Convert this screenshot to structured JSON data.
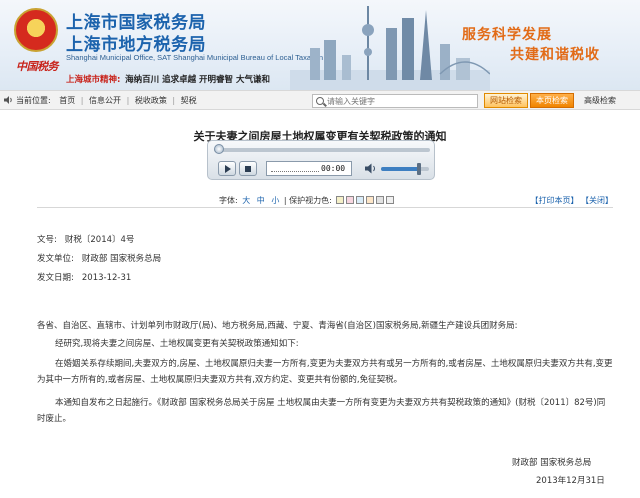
{
  "header": {
    "logo_text": "中国税务",
    "title_line1": "上海市国家税务局",
    "title_line2": "上海市地方税务局",
    "title_en_line1": "Shanghai Municipal Office, SAT  Shanghai Municipal Bureau of Local Taxation",
    "motto_label": "上海城市精神:",
    "motto_text": "海纳百川  追求卓越  开明睿智  大气谦和",
    "slogan_line1": "服务科学发展",
    "slogan_line2": "共建和谐税收"
  },
  "nav": {
    "location_label": "当前位置:",
    "breadcrumb": [
      "首页",
      "信息公开",
      "税收政策",
      "契税"
    ],
    "search_placeholder": "请输入关键字",
    "web_search_label": "网站检索",
    "site_search_label": "本页检索",
    "advanced_search_label": "高级检索"
  },
  "article": {
    "title": "关于夫妻之间房屋土地权属变更有关契税政策的通知",
    "player": {
      "time": "00:00",
      "volume_percent": 80
    },
    "toolbar": {
      "font_label": "字体:",
      "size_large": "大",
      "size_medium": "中",
      "size_small": "小",
      "eye_label": "保护视力色:",
      "eye_colors": [
        "#f5f0c8",
        "#f7d6e0",
        "#d9ecf8",
        "#fde6c8",
        "#e2e2e2",
        "#f0f0f0"
      ],
      "print_label": "【打印本页】",
      "close_label": "【关闭】"
    },
    "meta": {
      "doc_no_label": "文号:",
      "doc_no": "财税〔2014〕4号",
      "issuer_label": "发文单位:",
      "issuer": "财政部 国家税务总局",
      "date_label": "发文日期:",
      "date": "2013-12-31"
    },
    "body": {
      "p1": "各省、自治区、直辖市、计划单列市财政厅(局)、地方税务局,西藏、宁夏、青海省(自治区)国家税务局,新疆生产建设兵团财务局:",
      "p2": "经研究,现将夫妻之间房屋、土地权属变更有关契税政策通知如下:",
      "p3": "在婚姻关系存续期间,夫妻双方的,房屋、土地权属原归夫妻一方所有,变更为夫妻双方共有或另一方所有的,或者房屋、土地权属原归夫妻双方共有,变更为其中一方所有的,或者房屋、土地权属原归夫妻双方共有,双方约定、变更共有份额的,免征契税。",
      "p4": "本通知自发布之日起施行。《财政部 国家税务总局关于房屋 土地权属由夫妻一方所有变更为夫妻双方共有契税政策的通知》(财税〔2011〕82号)同时废止。"
    },
    "signature": {
      "issuer": "财政部 国家税务总局",
      "date": "2013年12月31日"
    }
  }
}
